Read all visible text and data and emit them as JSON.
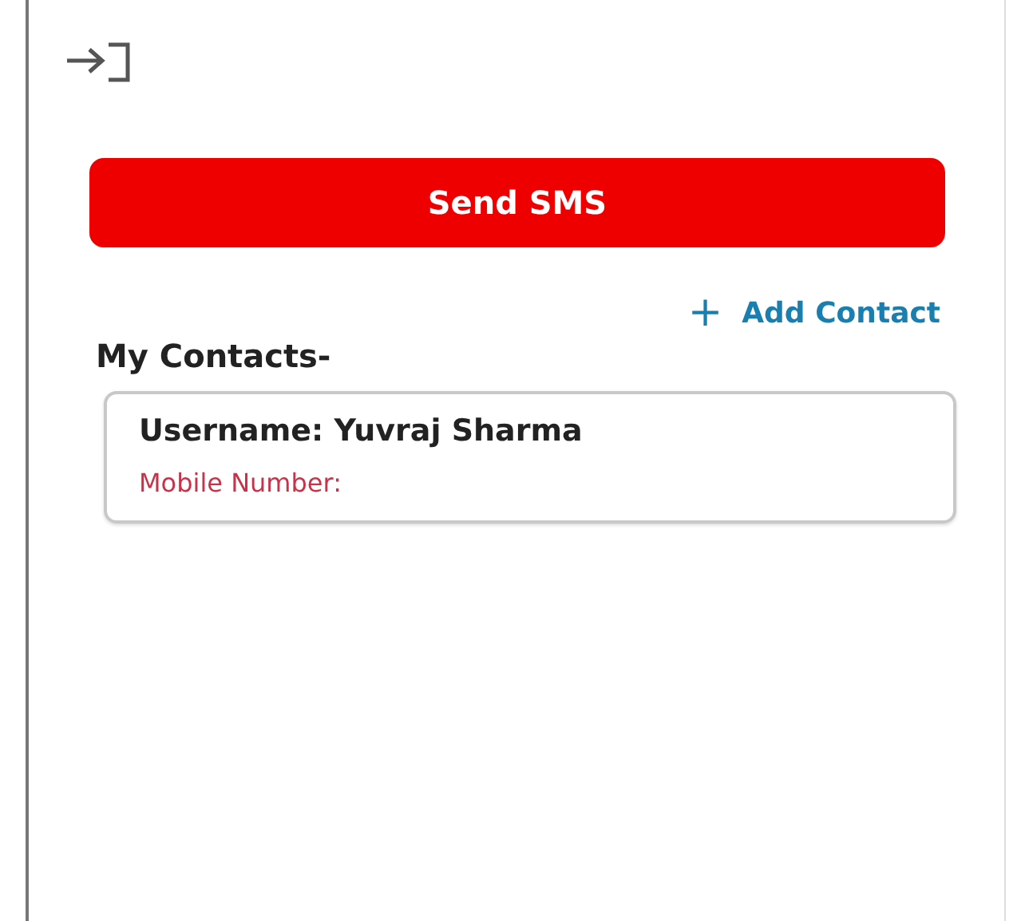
{
  "send_button": {
    "label": "Send SMS"
  },
  "add_contact": {
    "icon": "+",
    "label": "Add Contact"
  },
  "contacts_heading": "My Contacts-",
  "contacts": [
    {
      "username": "Username: Yuvraj Sharma",
      "mobile": "Mobile Number:"
    }
  ]
}
